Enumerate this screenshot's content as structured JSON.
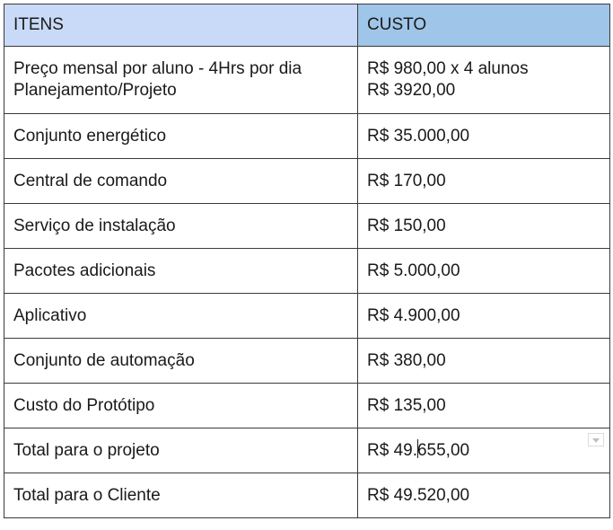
{
  "table": {
    "headers": [
      "ITENS",
      "CUSTO"
    ],
    "header_colors": [
      "#c9daf8",
      "#9fc5e8"
    ],
    "rows": [
      {
        "item": [
          "Preço mensal  por aluno - 4Hrs por dia",
          "Planejamento/Projeto"
        ],
        "cost": [
          "R$ 980,00 x 4 alunos",
          "R$ 3920,00"
        ]
      },
      {
        "item": [
          "Conjunto energético"
        ],
        "cost": [
          "R$ 35.000,00"
        ]
      },
      {
        "item": [
          "Central de comando"
        ],
        "cost": [
          "R$ 170,00"
        ]
      },
      {
        "item": [
          "Serviço de instalação"
        ],
        "cost": [
          "R$ 150,00"
        ]
      },
      {
        "item": [
          "Pacotes adicionais"
        ],
        "cost": [
          "R$ 5.000,00"
        ]
      },
      {
        "item": [
          "Aplicativo"
        ],
        "cost": [
          "R$ 4.900,00"
        ]
      },
      {
        "item": [
          "Conjunto de automação"
        ],
        "cost": [
          "R$ 380,00"
        ]
      },
      {
        "item": [
          "Custo do Protótipo"
        ],
        "cost": [
          "R$ 135,00"
        ]
      },
      {
        "item": [
          "Total para o projeto"
        ],
        "cost": [
          "R$ 49.655,00"
        ]
      },
      {
        "item": [
          "Total para o Cliente"
        ],
        "cost": [
          "R$ 49.520,00"
        ]
      }
    ]
  },
  "text_cursor": {
    "row": 8,
    "after_text": "R$ 49."
  },
  "icons": {
    "cell_menu": "dropdown-arrow-icon"
  }
}
